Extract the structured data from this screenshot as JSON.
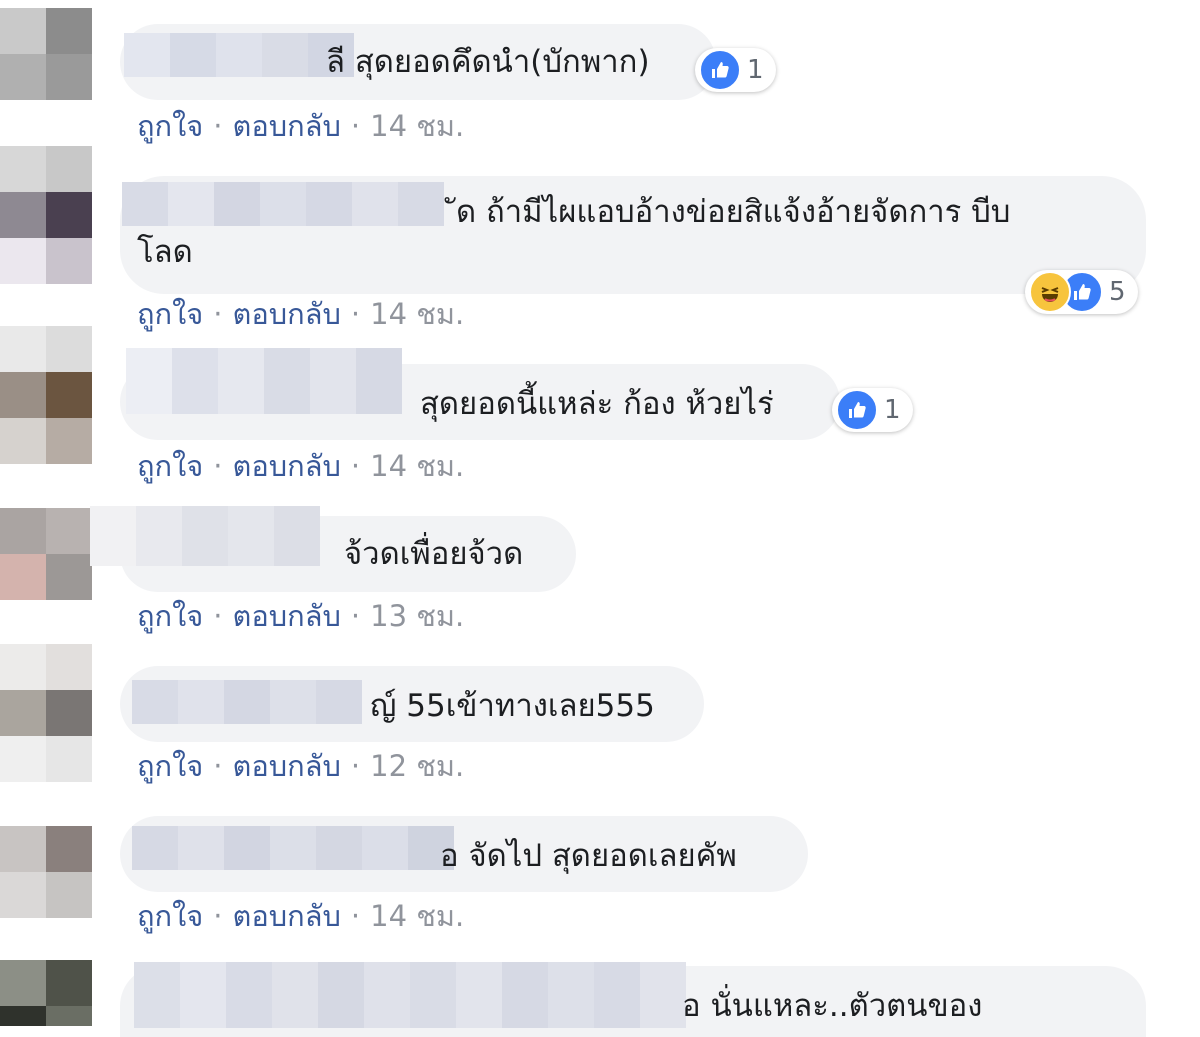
{
  "actions": {
    "like": "ถูกใจ",
    "reply": "ตอบกลับ",
    "separator": "·"
  },
  "comments": [
    {
      "text": "ลี สุดยอดคึดนำ(บักพาก)",
      "text2": "",
      "time": "14 ชม.",
      "reactions": {
        "icons": [
          "like-icon"
        ],
        "count": "1"
      }
    },
    {
      "text": "ัด ถ้ามีไผแอบอ้างข่อยสิแจ้งอ้ายจัดการ บีบ",
      "text2": "โลด",
      "time": "14 ชม.",
      "reactions": {
        "icons": [
          "haha-icon",
          "like-icon"
        ],
        "count": "5"
      }
    },
    {
      "text": "สุดยอดนี้แหล่ะ ก้อง ห้วยไร่",
      "text2": "",
      "time": "14 ชม.",
      "reactions": {
        "icons": [
          "like-icon"
        ],
        "count": "1"
      }
    },
    {
      "text": "จ้วดเพื่อยจ้วด",
      "text2": "",
      "time": "13 ชม.",
      "reactions": null
    },
    {
      "text": "ญ์ 55เข้าทางเลย555",
      "text2": "",
      "time": "12 ชม.",
      "reactions": null
    },
    {
      "text": "อ จัดไป สุดยอดเลยคัพ",
      "text2": "",
      "time": "14 ชม.",
      "reactions": null
    },
    {
      "text": "อ นั่นแหละ..ตัวตนของ",
      "text2": "",
      "time": "",
      "reactions": null
    }
  ],
  "colors": {
    "bubble": "#f2f3f5",
    "link": "#385898",
    "meta": "#90949c",
    "like": "#3b7ef8",
    "haha": "#f7c43d"
  }
}
